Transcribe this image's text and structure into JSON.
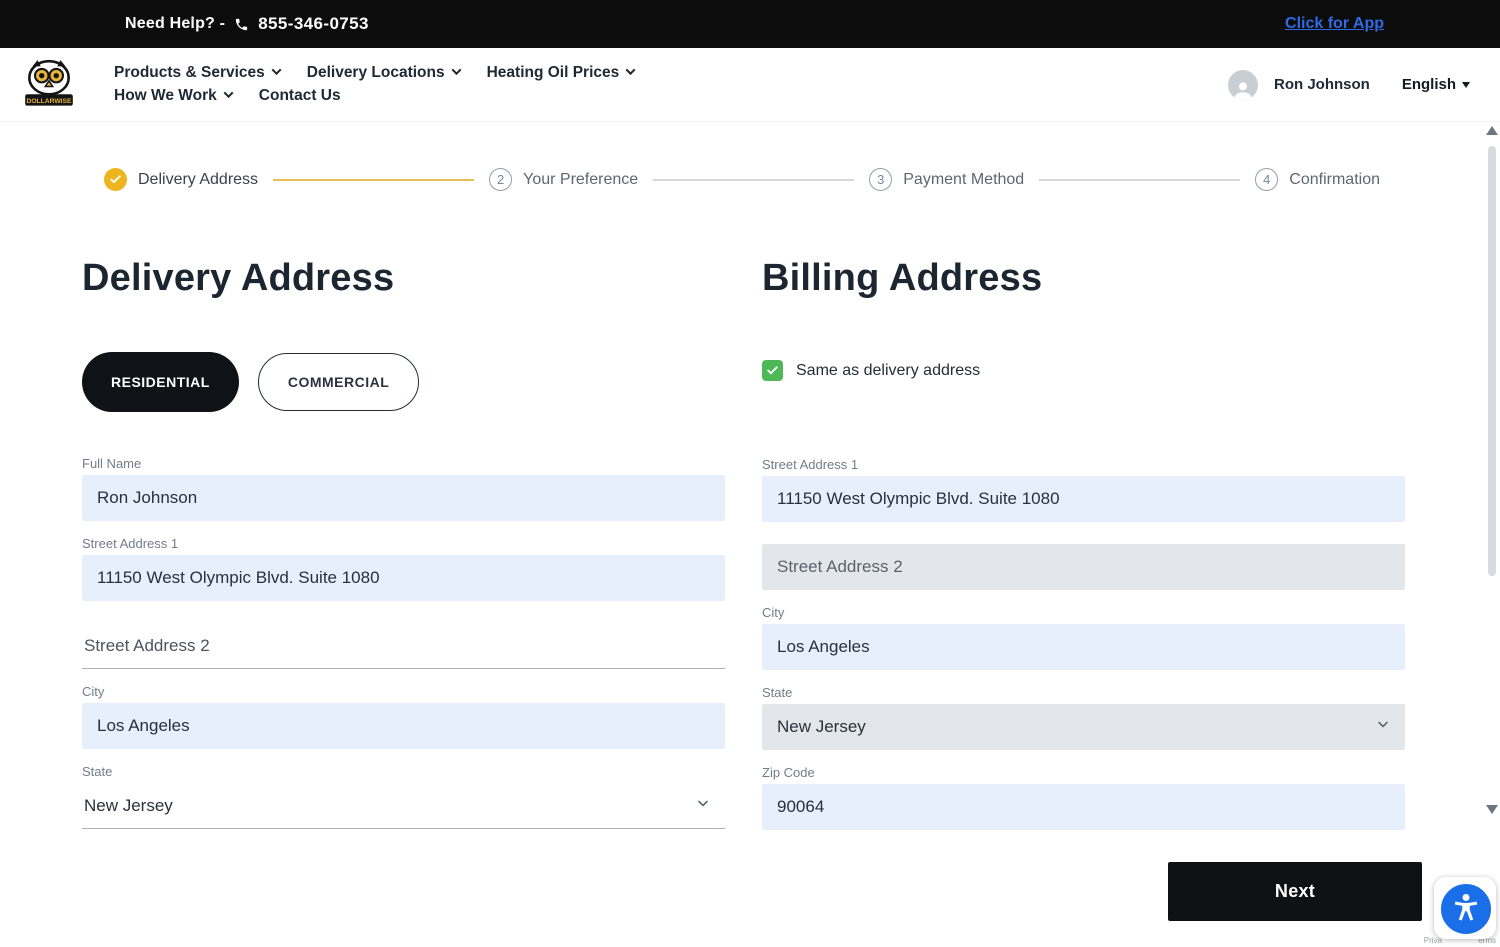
{
  "topbar": {
    "help_text": "Need Help? -",
    "phone": "855-346-0753",
    "app_link": "Click for App"
  },
  "header": {
    "logo_text": "DOLLARWISE",
    "nav": [
      {
        "label": "Products & Services"
      },
      {
        "label": "Delivery Locations"
      },
      {
        "label": "Heating Oil Prices"
      },
      {
        "label": "How We Work"
      },
      {
        "label": "Contact Us"
      }
    ],
    "user_name": "Ron Johnson",
    "language": "English"
  },
  "stepper": {
    "steps": [
      {
        "label": "Delivery Address",
        "state": "complete"
      },
      {
        "number": "2",
        "label": "Your Preference",
        "state": "upcoming"
      },
      {
        "number": "3",
        "label": "Payment Method",
        "state": "upcoming"
      },
      {
        "number": "4",
        "label": "Confirmation",
        "state": "upcoming"
      }
    ]
  },
  "delivery": {
    "title": "Delivery Address",
    "residential_label": "RESIDENTIAL",
    "commercial_label": "COMMERCIAL",
    "fields": {
      "full_name": {
        "label": "Full Name",
        "value": "Ron Johnson"
      },
      "street1": {
        "label": "Street Address 1",
        "value": "11150 West Olympic Blvd. Suite 1080"
      },
      "street2": {
        "placeholder": "Street Address 2"
      },
      "city": {
        "label": "City",
        "value": "Los Angeles"
      },
      "state": {
        "label": "State",
        "value": "New Jersey"
      }
    }
  },
  "billing": {
    "title": "Billing Address",
    "same_label": "Same as delivery address",
    "fields": {
      "street1": {
        "label": "Street Address 1",
        "value": "11150 West Olympic Blvd. Suite 1080"
      },
      "street2": {
        "placeholder": "Street Address 2"
      },
      "city": {
        "label": "City",
        "value": "Los Angeles"
      },
      "state": {
        "label": "State",
        "value": "New Jersey"
      },
      "zip": {
        "label": "Zip Code",
        "value": "90064"
      }
    }
  },
  "footer": {
    "next_label": "Next"
  },
  "misc": {
    "privacy_left": "Priva",
    "privacy_right": "erms"
  },
  "colors": {
    "accent_gold": "#edb41e",
    "link_blue": "#2e6be5",
    "checkbox_green": "#4eb857",
    "primary_black": "#0f1318",
    "input_blue": "#e8effc",
    "input_gray": "#e3e7eb"
  }
}
